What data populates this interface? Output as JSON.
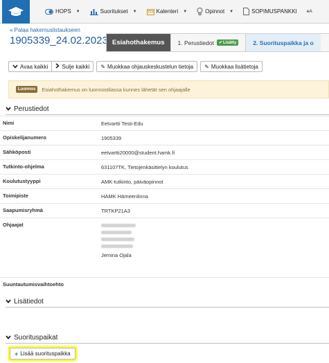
{
  "nav": {
    "items": [
      {
        "label": "HOPS",
        "icon": "toggle-icon",
        "dropdown": true
      },
      {
        "label": "Suoritukset",
        "icon": "bar-chart-icon",
        "dropdown": true
      },
      {
        "label": "Kalenteri",
        "icon": "calendar-icon",
        "dropdown": true
      },
      {
        "label": "Opinnot",
        "icon": "lightbulb-icon",
        "dropdown": true
      },
      {
        "label": "SOPIMUSPANKKI",
        "icon": "document-icon",
        "dropdown": false
      },
      {
        "label": "eA",
        "icon": "",
        "dropdown": false
      }
    ]
  },
  "header": {
    "back_link": "« Palaa hakemuslistaukseen",
    "application_id": "1905339_24.02.2023_1",
    "tab_active": "Esiahothakemus",
    "tab1_label": "1. Perustiedot",
    "tab1_badge": "Lisätty",
    "tab2_label": "2. Suorituspaikka ja o"
  },
  "toolbar": {
    "expand_all": "Avaa kaikki",
    "collapse_all": "Sulje kaikki",
    "edit_guidance": "Muokkaa ohjauskeskustelun tietoja",
    "edit_extra": "Muokkaa lisätietoja"
  },
  "notice": {
    "badge": "Luonnos",
    "text": "Esiahothakemus on luonnostilassa kunnes lähetät sen ohjaajalle"
  },
  "sections": {
    "basic": "Perustiedot",
    "extra": "Lisätiedot",
    "places": "Suorituspaikat"
  },
  "fields": {
    "name_label": "Nimi",
    "name_value": "Eetvartti Testi-Edu",
    "student_no_label": "Opiskelijanumero",
    "student_no_value": "1905339",
    "email_label": "Sähköposti",
    "email_value": "eetvartti20000@student.hamk.fi",
    "degree_label": "Tutkinto-ohjelma",
    "degree_value": "631107TK, Tietojenkäsittelyn koulutus",
    "edu_type_label": "Koulutustyyppi",
    "edu_type_value": "AMK-tutkinto, päiväopinnot",
    "office_label": "Toimipiste",
    "office_value": "HAMK Hämeenlinna",
    "group_label": "Saapumisryhmä",
    "group_value": "TRTKP21A3",
    "supervisors_label": "Ohjaajat",
    "supervisor_visible": "Jemina Ojala",
    "orientation_label": "Suuntautumisvaihtoehto"
  },
  "actions": {
    "add_place": "Lisää suorituspaikka"
  }
}
